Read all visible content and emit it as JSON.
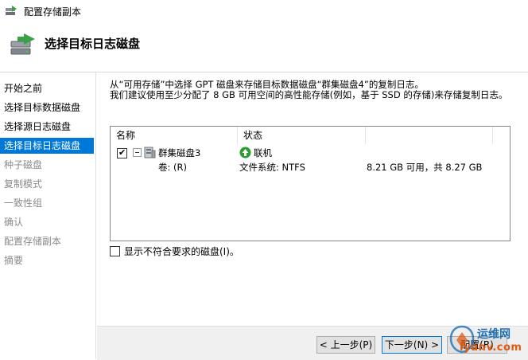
{
  "window": {
    "title": "配置存储副本"
  },
  "header": {
    "title": "选择目标日志磁盘"
  },
  "sidebar": {
    "items": [
      {
        "label": "开始之前",
        "state": "normal"
      },
      {
        "label": "选择目标数据磁盘",
        "state": "normal"
      },
      {
        "label": "选择源日志磁盘",
        "state": "normal"
      },
      {
        "label": "选择目标日志磁盘",
        "state": "active"
      },
      {
        "label": "种子磁盘",
        "state": "disabled"
      },
      {
        "label": "复制模式",
        "state": "disabled"
      },
      {
        "label": "一致性组",
        "state": "disabled"
      },
      {
        "label": "确认",
        "state": "disabled"
      },
      {
        "label": "配置存储副本",
        "state": "disabled"
      },
      {
        "label": "摘要",
        "state": "disabled"
      }
    ]
  },
  "content": {
    "desc_line1": "从“可用存储”中选择 GPT 磁盘来存储目标数据磁盘“群集磁盘4”的复制日志。",
    "desc_line2": "我们建议使用至少分配了 8 GB 可用空间的高性能存储(例如，基于 SSD 的存储)来存储复制日志。",
    "columns": {
      "name": "名称",
      "status": "状态"
    },
    "disk": {
      "name": "群集磁盘3",
      "status": "联机",
      "checked": true,
      "volume": "卷: (R)",
      "filesystem": "文件系统: NTFS",
      "capacity": "8.21 GB 可用，共 8.27 GB"
    },
    "show_ineligible_label": "显示不符合要求的磁盘(I)。"
  },
  "footer": {
    "prev_label": "< 上一步(P)",
    "next_label": "下一步(N) >",
    "configure_label": "配置(R)"
  },
  "watermark": {
    "text1": "运维网",
    "text2": "iyunv.com"
  },
  "colors": {
    "accent": "#0078d7",
    "online": "#2e9b2e"
  }
}
